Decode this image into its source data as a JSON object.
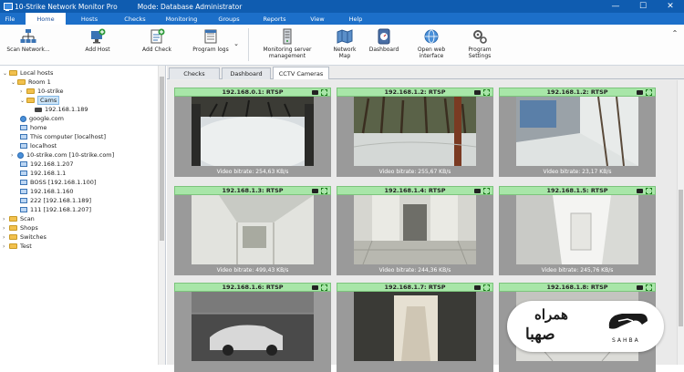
{
  "titlebar": {
    "title": "10-Strike Network Monitor Pro",
    "mode": "Mode: Database Administrator",
    "minimize": "—",
    "maximize": "☐",
    "close": "✕"
  },
  "menu": [
    "File",
    "Home",
    "Hosts",
    "Checks",
    "Monitoring",
    "Groups",
    "Reports",
    "View",
    "Help"
  ],
  "menu_active": "Home",
  "ribbon": {
    "scan": "Scan Network...",
    "add_host": "Add Host",
    "add_check": "Add Check",
    "program_logs": "Program logs",
    "monitoring_server_1": "Monitoring server",
    "monitoring_server_2": "management",
    "network_map_1": "Network",
    "network_map_2": "Map",
    "dashboard": "Dashboard",
    "open_web_1": "Open web",
    "open_web_2": "interface",
    "program_settings_1": "Program",
    "program_settings_2": "Settings"
  },
  "tree": {
    "local_hosts": "Local hosts",
    "room1": "Room 1",
    "ten_strike": "10-strike",
    "cams": "Cams",
    "cam_ip": "192.168.1.189",
    "google": "google.com",
    "home": "home",
    "this_computer": "This computer [localhost]",
    "localhost": "localhost",
    "ten_strike_com": "10-strike.com [10-strike.com]",
    "h207": "192.168.1.207",
    "h1": "192.168.1.1",
    "boss": "BOSS [192.168.1.100]",
    "h160": "192.168.1.160",
    "h222": "222 [192.168.1.189]",
    "h111": "111 [192.168.1.207]",
    "scan": "Scan",
    "shops": "Shops",
    "switches": "Switches",
    "test": "Test"
  },
  "tabs": [
    "Checks",
    "Dashboard",
    "CCTV Cameras"
  ],
  "tab_active": "CCTV Cameras",
  "cameras": [
    {
      "title": "192.168.0.1: RTSP",
      "bitrate": "Video bitrate: 254,63 KB/s"
    },
    {
      "title": "192.168.1.2: RTSP",
      "bitrate": "Video bitrate: 255,67 KB/s"
    },
    {
      "title": "192.168.1.2: RTSP",
      "bitrate": "Video bitrate: 23,17 KB/s"
    },
    {
      "title": "192.168.1.3: RTSP",
      "bitrate": "Video bitrate: 499,43 KB/s"
    },
    {
      "title": "192.168.1.4: RTSP",
      "bitrate": "Video bitrate: 244,36 KB/s"
    },
    {
      "title": "192.168.1.5: RTSP",
      "bitrate": "Video bitrate: 245,76 KB/s"
    },
    {
      "title": "192.168.1.6: RTSP",
      "bitrate": ""
    },
    {
      "title": "192.168.1.7: RTSP",
      "bitrate": ""
    },
    {
      "title": "192.168.1.8: RTSP",
      "bitrate": ""
    }
  ],
  "watermark": {
    "line1": "همراه",
    "line2": "صهبا",
    "latin": "SAHBA"
  }
}
